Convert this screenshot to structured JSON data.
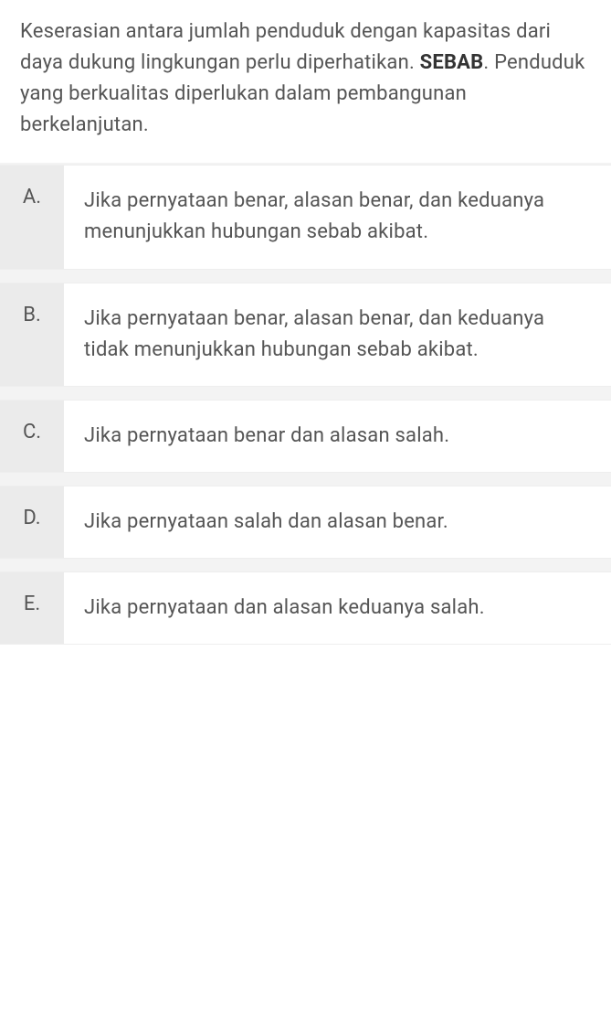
{
  "question": {
    "text_before": " Keserasian antara jumlah penduduk dengan kapasitas dari daya dukung lingkungan perlu diperhatikan. ",
    "bold": "SEBAB",
    "text_after": ". Penduduk yang berkualitas diperlukan dalam pembangunan berkelanjutan."
  },
  "options": [
    {
      "letter": "A.",
      "text": "Jika pernyataan benar, alasan benar, dan keduanya menunjukkan hubungan sebab akibat."
    },
    {
      "letter": "B.",
      "text": "Jika pernyataan benar, alasan benar, dan keduanya tidak menunjukkan hubungan sebab akibat."
    },
    {
      "letter": "C.",
      "text": "Jika pernyataan benar dan alasan salah."
    },
    {
      "letter": "D.",
      "text": "Jika pernyataan salah dan alasan benar."
    },
    {
      "letter": "E.",
      "text": "Jika pernyataan dan alasan keduanya salah."
    }
  ]
}
